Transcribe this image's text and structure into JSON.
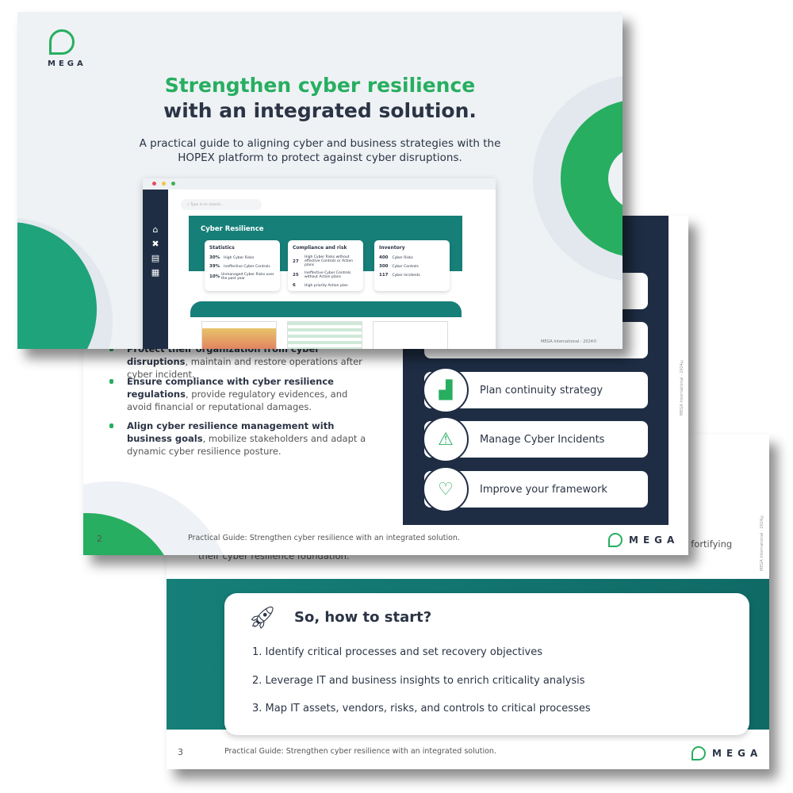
{
  "slide3": {
    "partial_text_right": "cies fortifying",
    "partial_text_left": "their cyber resilience foundation.",
    "copyright": "MEGA International - 2024©",
    "card_title": "So, how to start?",
    "icon": "rocket-icon",
    "steps": [
      "1.   Identify critical processes and set recovery objectives",
      "2.   Leverage IT and business insights to enrich criticality analysis",
      "3.   Map IT assets, vendors, risks, and controls to critical processes"
    ],
    "page_number": "3",
    "footer": "Practical Guide: Strengthen cyber resilience with an integrated solution.",
    "logo": "MEGA"
  },
  "slide2": {
    "bullets": [
      {
        "bold": "Protect their organization from cyber disruptions",
        "rest": ", maintain and restore operations after cyber incident."
      },
      {
        "bold": "Ensure compliance with cyber resilience regulations",
        "rest": ", provide regulatory evidences, and avoid financial or reputational damages."
      },
      {
        "bold": "Align cyber resilience management with business goals",
        "rest": ", mobilize stakeholders and adapt a dynamic cyber resilience posture."
      }
    ],
    "steps": [
      {
        "label": "Plan continuity strategy",
        "icon": "stairs-icon"
      },
      {
        "label": "Manage Cyber Incidents",
        "icon": "warning-icon"
      },
      {
        "label": "Improve your framework",
        "icon": "heartbeat-icon"
      }
    ],
    "copyright": "MEGA International - 2024©",
    "page_number": "2",
    "footer": "Practical Guide: Strengthen cyber resilience with an integrated solution.",
    "logo": "MEGA"
  },
  "slide1": {
    "logo": "MEGA",
    "title_line1": "Strengthen cyber resilience",
    "title_line2": "with an integrated solution.",
    "subtitle": "A practical guide to aligning cyber and business strategies with the HOPEX platform to protect against cyber disruptions.",
    "copyright": "MEGA International - 2024©",
    "app": {
      "search_placeholder": "Type in to search...",
      "banner_title": "Cyber Resilience",
      "cards": [
        {
          "title": "Statistics",
          "rows": [
            [
              "30%",
              "High Cyber Risks"
            ],
            [
              "39%",
              "Ineffective Cyber Controls"
            ],
            [
              "10%",
              "Unmanaged Cyber Risks over the past year"
            ]
          ]
        },
        {
          "title": "Compliance and risk",
          "rows": [
            [
              "27",
              "High Cyber Risks without effective Controls or Action plans"
            ],
            [
              "25",
              "Ineffective Cyber Controls without Action plans"
            ],
            [
              "6",
              "High priority Action plan"
            ]
          ]
        },
        {
          "title": "Inventory",
          "rows": [
            [
              "400",
              "Cyber Risks"
            ],
            [
              "300",
              "Cyber Controls"
            ],
            [
              "117",
              "Cyber Incidents"
            ]
          ]
        }
      ],
      "nav_icons": [
        "home-icon",
        "tools-icon",
        "report-icon",
        "grid-icon"
      ]
    }
  },
  "colors": {
    "green": "#27ae60",
    "teal": "#167f78",
    "navy": "#1e2d44",
    "title_green": "#27ae60"
  }
}
